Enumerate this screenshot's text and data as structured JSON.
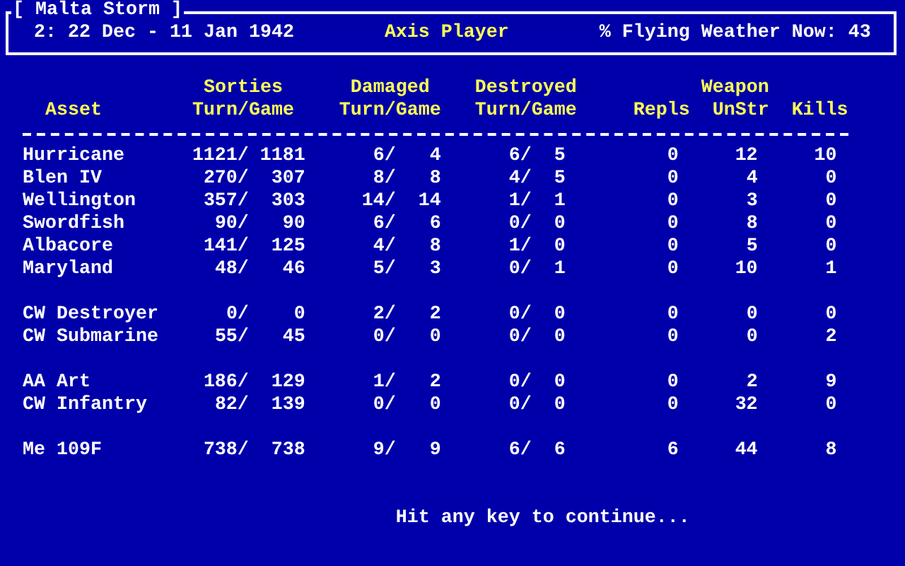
{
  "window": {
    "title": "[ Malta Storm ]"
  },
  "info": {
    "period": "2: 22 Dec - 11 Jan 1942",
    "player": "Axis Player",
    "weather": "% Flying Weather Now: 43"
  },
  "table": {
    "group_headers": [
      "Sorties",
      "Damaged",
      "Destroyed",
      "Weapon"
    ],
    "columns": [
      "Asset",
      "Turn/Game",
      "Turn/Game",
      "Turn/Game",
      "Repls",
      "UnStr",
      "Kills"
    ],
    "groups": [
      {
        "rows": [
          [
            "Hurricane",
            "1121/",
            "1181",
            "6/",
            "4",
            "6/",
            "5",
            "0",
            "12",
            "10"
          ],
          [
            "Blen IV",
            "270/",
            "307",
            "8/",
            "8",
            "4/",
            "5",
            "0",
            "4",
            "0"
          ],
          [
            "Wellington",
            "357/",
            "303",
            "14/",
            "14",
            "1/",
            "1",
            "0",
            "3",
            "0"
          ],
          [
            "Swordfish",
            "90/",
            "90",
            "6/",
            "6",
            "0/",
            "0",
            "0",
            "8",
            "0"
          ],
          [
            "Albacore",
            "141/",
            "125",
            "4/",
            "8",
            "1/",
            "0",
            "0",
            "5",
            "0"
          ],
          [
            "Maryland",
            "48/",
            "46",
            "5/",
            "3",
            "0/",
            "1",
            "0",
            "10",
            "1"
          ]
        ]
      },
      {
        "rows": [
          [
            "CW Destroyer",
            "0/",
            "0",
            "2/",
            "2",
            "0/",
            "0",
            "0",
            "0",
            "0"
          ],
          [
            "CW Submarine",
            "55/",
            "45",
            "0/",
            "0",
            "0/",
            "0",
            "0",
            "0",
            "2"
          ]
        ]
      },
      {
        "rows": [
          [
            "AA Art",
            "186/",
            "129",
            "1/",
            "2",
            "0/",
            "0",
            "0",
            "2",
            "9"
          ],
          [
            "CW Infantry",
            "82/",
            "139",
            "0/",
            "0",
            "0/",
            "0",
            "0",
            "32",
            "0"
          ]
        ]
      },
      {
        "rows": [
          [
            "Me 109F",
            "738/",
            "738",
            "9/",
            "9",
            "6/",
            "6",
            "6",
            "44",
            "8"
          ]
        ]
      }
    ]
  },
  "prompt": "Hit any key to continue..."
}
